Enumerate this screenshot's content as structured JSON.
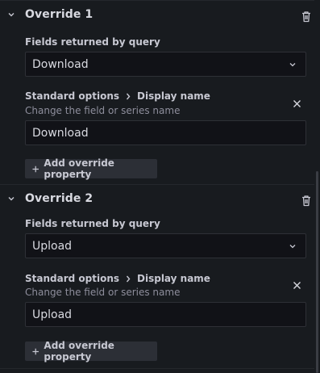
{
  "overrides": [
    {
      "title": "Override 1",
      "fields_label": "Fields returned by query",
      "fields_value": "Download",
      "property": {
        "category": "Standard options",
        "name": "Display name",
        "description": "Change the field or series name",
        "value": "Download"
      },
      "add_property_label": "Add override property"
    },
    {
      "title": "Override 2",
      "fields_label": "Fields returned by query",
      "fields_value": "Upload",
      "property": {
        "category": "Standard options",
        "name": "Display name",
        "description": "Change the field or series name",
        "value": "Upload"
      },
      "add_property_label": "Add override property"
    }
  ],
  "icons": {
    "collapse": "chevron-down-icon",
    "delete": "trash-icon",
    "select_caret": "chevron-down-icon",
    "separator": "chevron-right-icon",
    "remove": "close-icon",
    "add": "plus-icon"
  },
  "colors": {
    "background": "#181b1f",
    "input_background": "#111217",
    "button_background": "#2c2f36",
    "text": "#d8d9e0",
    "muted_text": "#8e8e9c"
  }
}
